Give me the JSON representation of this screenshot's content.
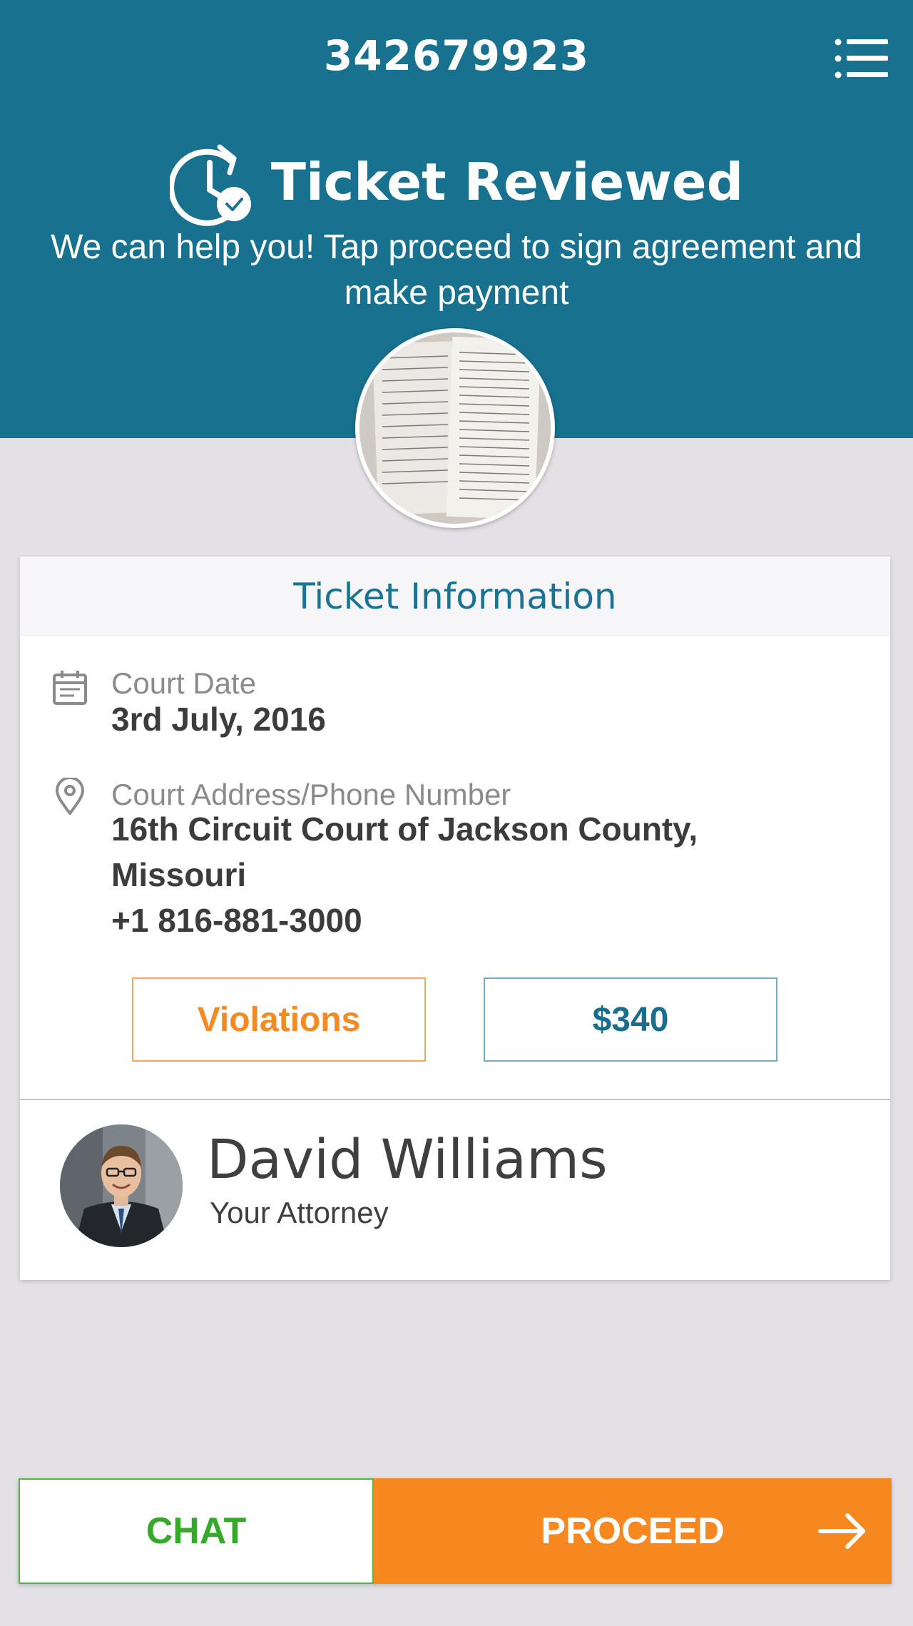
{
  "header": {
    "ticket_number": "342679923",
    "status_title": "Ticket Reviewed",
    "status_message": "We can help you! Tap proceed to sign agreement and make payment",
    "menu_icon": "list-menu-icon",
    "status_icon": "clock-check-icon"
  },
  "ticket_info": {
    "title": "Ticket Information",
    "court_date_label": "Court Date",
    "court_date_value": "3rd July, 2016",
    "court_address_label": "Court Address/Phone Number",
    "court_address_line1": "16th Circuit Court of Jackson County,",
    "court_address_line2": "Missouri",
    "court_phone": "+1 816-881-3000",
    "violations_label": "Violations",
    "amount_label": "$340"
  },
  "attorney": {
    "name": "David Williams",
    "role": "Your Attorney"
  },
  "actions": {
    "chat_label": "CHAT",
    "proceed_label": "PROCEED"
  },
  "colors": {
    "header_bg": "#17718f",
    "accent_orange": "#f6881f",
    "chat_green": "#35a92a",
    "page_bg": "#e3e1e5"
  }
}
